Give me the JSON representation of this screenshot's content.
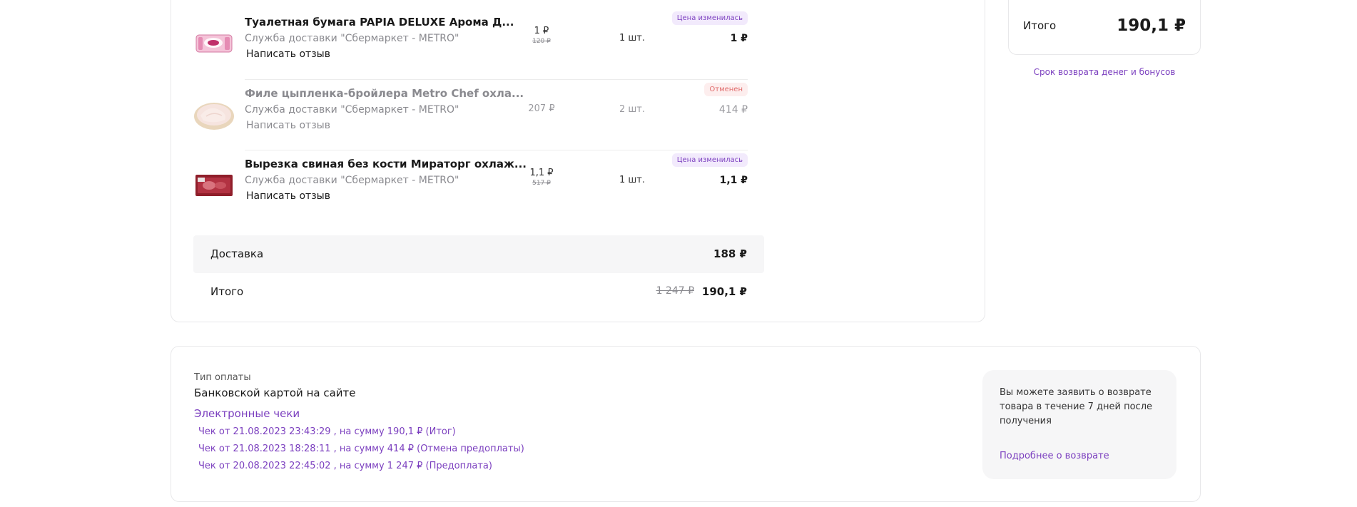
{
  "items": [
    {
      "name": "Туалетная бумага PAPIA DELUXE Арома Д...",
      "service": "Служба доставки \"Сбермаркет - METRO\"",
      "review": "Написать отзыв",
      "price": "1 ₽",
      "old_price": "120 ₽",
      "qty": "1 шт.",
      "total": "1 ₽",
      "badge": "Цена изменилась",
      "status": "changed"
    },
    {
      "name": "Филе цыпленка-бройлера Metro Chef охла...",
      "service": "Служба доставки \"Сбермаркет - METRO\"",
      "review": "Написать отзыв",
      "price": "207 ₽",
      "qty": "2 шт.",
      "total": "414 ₽",
      "badge": "Отменен",
      "status": "cancelled"
    },
    {
      "name": "Вырезка свиная без кости Мираторг охлаж...",
      "service": "Служба доставки \"Сбермаркет - METRO\"",
      "review": "Написать отзыв",
      "price": "1,1 ₽",
      "old_price": "517 ₽",
      "qty": "1 шт.",
      "total": "1,1 ₽",
      "badge": "Цена изменилась",
      "status": "changed"
    }
  ],
  "delivery": {
    "label": "Доставка",
    "value": "188 ₽"
  },
  "order_total": {
    "label": "Итого",
    "old_value": "1 247 ₽",
    "value": "190,1 ₽"
  },
  "summary": {
    "label": "Итого",
    "value": "190,1 ₽",
    "refund_link": "Срок возврата денег и бонусов"
  },
  "payment": {
    "label": "Тип оплаты",
    "method": "Банковской картой на сайте",
    "receipts_title": "Электронные чеки",
    "receipts": [
      "Чек от 21.08.2023 23:43:29 , на сумму 190,1 ₽ (Итог)",
      "Чек от 21.08.2023 18:28:11 , на сумму 414 ₽ (Отмена предоплаты)",
      "Чек от 20.08.2023 22:45:02 , на сумму 1 247 ₽ (Предоплата)"
    ]
  },
  "return_info": {
    "text": "Вы можете заявить о возврате товара в течение 7 дней после получения",
    "link": "Подробнее о возврате"
  },
  "colors": {
    "accent": "#7b3fbf",
    "badge_changed_bg": "#f2eafc",
    "badge_cancelled_bg": "#fdeeee",
    "badge_cancelled_text": "#e06b6b",
    "muted": "#8a8a8f"
  },
  "icons": [
    "toilet-paper-product-icon",
    "chicken-fillet-product-icon",
    "pork-tenderloin-product-icon"
  ]
}
